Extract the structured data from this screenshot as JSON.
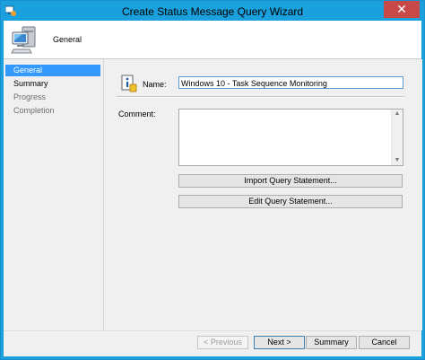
{
  "window": {
    "title": "Create Status Message Query Wizard",
    "close_glyph": "✕"
  },
  "header": {
    "title": "General",
    "icon": "computer-icon"
  },
  "nav": {
    "items": [
      {
        "label": "General",
        "state": "selected"
      },
      {
        "label": "Summary",
        "state": "enabled"
      },
      {
        "label": "Progress",
        "state": "disabled"
      },
      {
        "label": "Completion",
        "state": "disabled"
      }
    ]
  },
  "form": {
    "name_label": "Name:",
    "name_value": "Windows 10 - Task Sequence Monitoring",
    "comment_label": "Comment:",
    "comment_value": "",
    "import_button": "Import Query Statement...",
    "edit_button": "Edit Query Statement..."
  },
  "footer": {
    "previous": "< Previous",
    "next": "Next >",
    "summary": "Summary",
    "cancel": "Cancel"
  },
  "colors": {
    "title_bar": "#1aa0dc",
    "selected_nav": "#3399ff",
    "close_button": "#c74a48"
  }
}
